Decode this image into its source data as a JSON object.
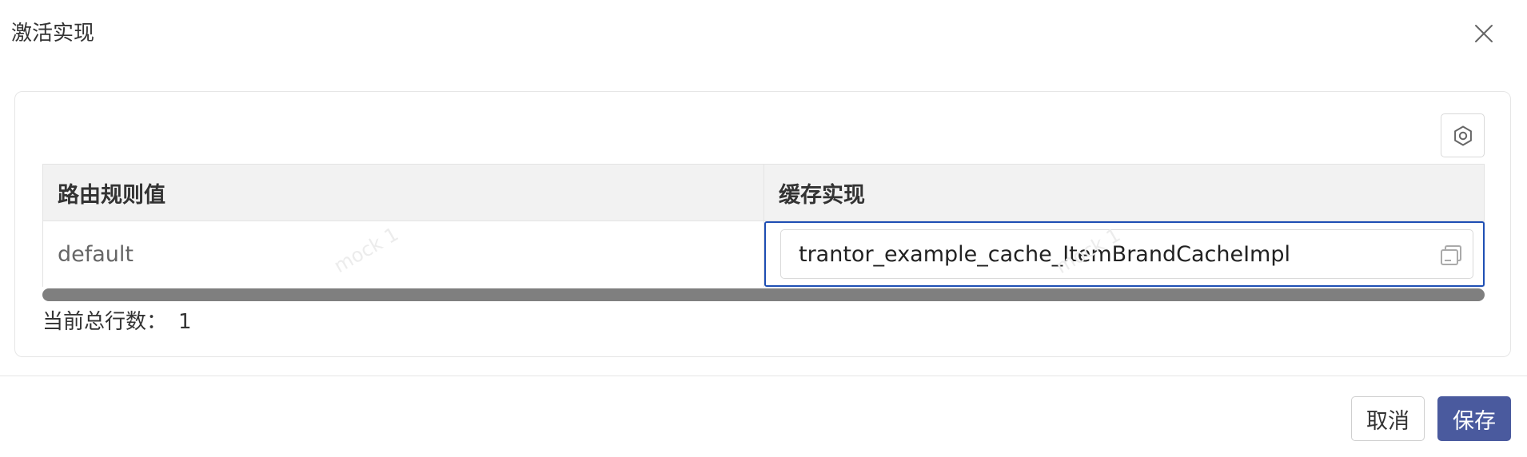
{
  "dialog": {
    "title": "激活实现",
    "close_icon": "close-icon"
  },
  "toolbar": {
    "settings_icon": "gear-icon"
  },
  "table": {
    "columns": [
      "路由规则值",
      "缓存实现"
    ],
    "rows": [
      {
        "rule": "default",
        "cache_impl": "trantor_example_cache_ItemBrandCacheImpl"
      }
    ],
    "watermark": "mock 1",
    "copy_icon": "copy-icon"
  },
  "summary": {
    "label": "当前总行数：",
    "value": "1"
  },
  "footer": {
    "cancel_label": "取消",
    "save_label": "保存"
  },
  "colors": {
    "primary": "#4a5a9e",
    "active_border": "#1f4fb4",
    "header_bg": "#f2f2f2",
    "scrollbar": "#7f7f7f"
  }
}
